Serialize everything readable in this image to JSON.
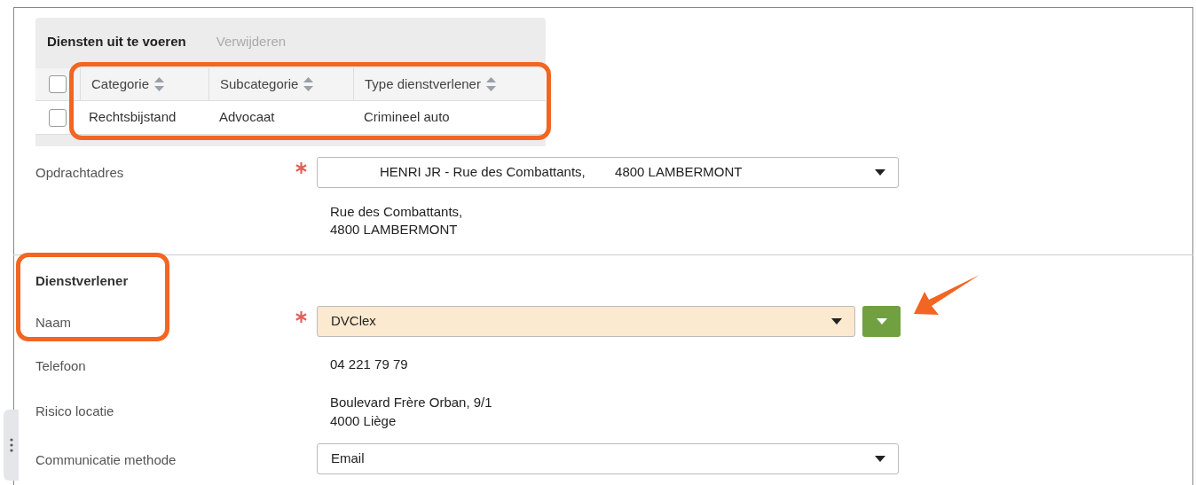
{
  "services_table": {
    "title": "Diensten uit te voeren",
    "actions": [
      {
        "label": "Verwijderen",
        "disabled": true
      }
    ],
    "columns": [
      "Categorie",
      "Subcategorie",
      "Type dienstverlener"
    ],
    "select_all": {
      "checked": false
    },
    "rows": [
      {
        "checked": false,
        "cells": [
          "Rechtsbijstand",
          "Advocaat",
          "Crimineel auto"
        ]
      }
    ]
  },
  "assignment": {
    "label": "Opdrachtadres",
    "required": true,
    "value": "HENRI JR - Rue des Combattants,        4800 LAMBERMONT",
    "address_lines": [
      "Rue des Combattants,",
      "4800 LAMBERMONT"
    ]
  },
  "provider": {
    "title": "Dienstverlener",
    "fields": [
      {
        "kind": "select",
        "label": "Naam",
        "required": true,
        "value": "DVClex",
        "highlighted": true,
        "extra_button": true
      },
      {
        "kind": "text",
        "label": "Telefoon",
        "lines": [
          "04 221 79 79"
        ]
      },
      {
        "kind": "text",
        "label": "Risico locatie",
        "lines": [
          "Boulevard Frère Orban, 9/1",
          "4000 Liège"
        ]
      },
      {
        "kind": "select",
        "label": "Communicatie methode",
        "required": false,
        "value": "Email",
        "highlighted": false,
        "extra_button": false
      }
    ]
  }
}
